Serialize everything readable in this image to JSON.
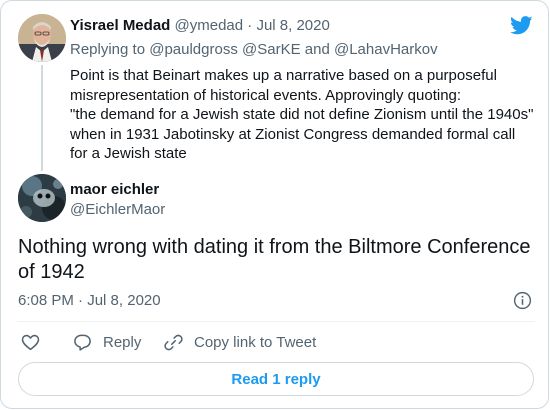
{
  "parent_tweet": {
    "display_name": "Yisrael Medad",
    "handle": "@ymedad",
    "separator": "·",
    "date": "Jul 8, 2020",
    "replying_label": "Replying to",
    "mentions": [
      "@pauldgross",
      "@SarKE",
      "@LahavHarkov"
    ],
    "mention_joiner": "and",
    "body_lines": [
      "Point is that Beinart makes up a narrative based on a purposeful",
      "misrepresentation of historical events. Approvingly quoting:",
      "\"the demand for a Jewish state did not define Zionism until the 1940s\"",
      "when in 1931 Jabotinsky at Zionist Congress demanded formal call",
      "for a Jewish state"
    ]
  },
  "main_tweet": {
    "display_name": "maor eichler",
    "handle": "@EichlerMaor",
    "body_lines": [
      "Nothing wrong with dating it from the Biltmore Conference",
      "of 1942"
    ],
    "time": "6:08 PM",
    "separator": "·",
    "date": "Jul 8, 2020"
  },
  "actions": {
    "like_icon": "heart-icon",
    "reply_label": "Reply",
    "reply_icon": "speech-bubble-icon",
    "copy_label": "Copy link to Tweet",
    "copy_icon": "link-icon"
  },
  "read_replies_label": "Read 1 reply",
  "icons": {
    "brand": "twitter-bird-icon",
    "info": "info-icon"
  },
  "colors": {
    "brand_blue": "#1d9bf0",
    "text": "#0f1419",
    "muted": "#536471",
    "border": "#cfd9de"
  }
}
